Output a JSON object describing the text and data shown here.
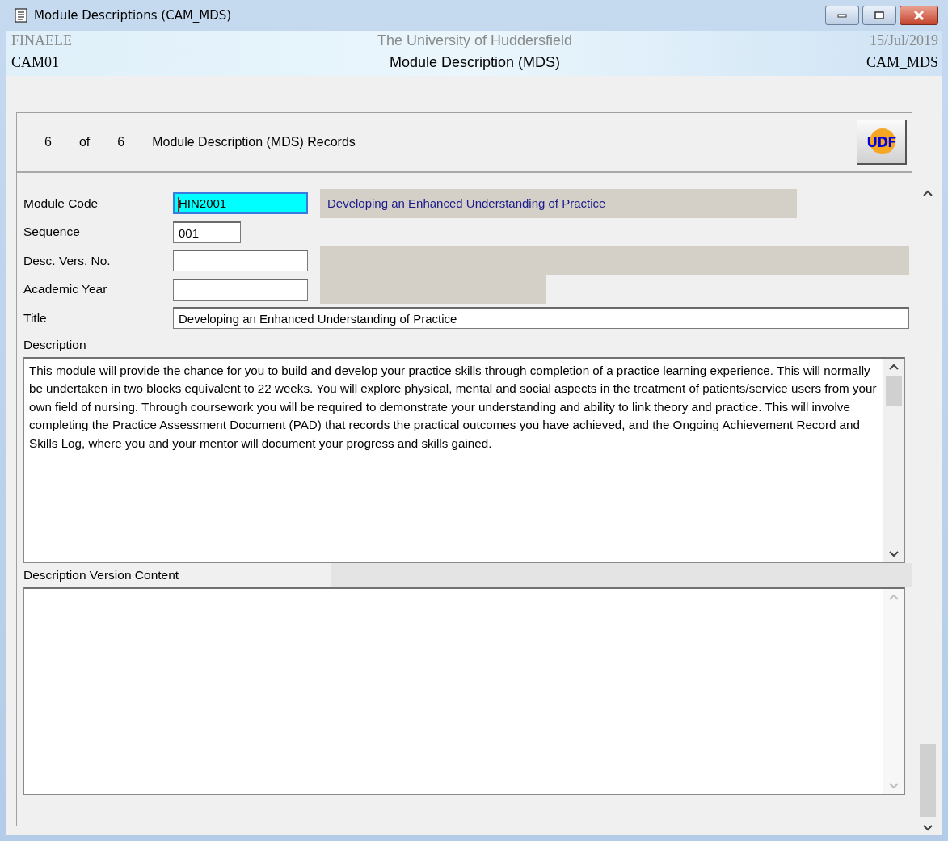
{
  "window": {
    "title": "Module Descriptions (CAM_MDS)"
  },
  "header": {
    "left_top": "FINAELE",
    "center_top": "The University of Huddersfield",
    "right_top": "15/Jul/2019",
    "left_bottom": "CAM01",
    "center_bottom": "Module Description (MDS)",
    "right_bottom": "CAM_MDS"
  },
  "records": {
    "current": "6",
    "of": "of",
    "total": "6",
    "label": "Module Description (MDS) Records",
    "udf_button": "UDF"
  },
  "fields": [
    {
      "label": "Module Code",
      "value": "HIN2001",
      "focused": true,
      "readonly_value": "Developing an Enhanced Understanding of Practice"
    },
    {
      "label": "Sequence",
      "value": "001",
      "focused": false
    },
    {
      "label": "Desc. Vers. No.",
      "focused": false
    },
    {
      "label": "Academic Year",
      "focused": false
    },
    {
      "label": "Title",
      "value": "Developing an Enhanced Understanding of Practice",
      "focused": false
    }
  ],
  "description": {
    "label": "Description",
    "value": "This module will provide the chance for you to build and develop your practice skills through completion of a practice learning experience. This will normally be undertaken in two blocks equivalent to 22 weeks. You will explore physical, mental and social aspects in the treatment of patients/service users from your own field of nursing. Through coursework you will be required to demonstrate your understanding and ability to link theory and practice. This will involve completing the Practice Assessment Document (PAD) that records the practical outcomes you have achieved, and the Ongoing Achievement Record and Skills Log, where you and your mentor will document your progress and skills gained."
  },
  "version_content": {
    "label": "Description Version Content"
  }
}
